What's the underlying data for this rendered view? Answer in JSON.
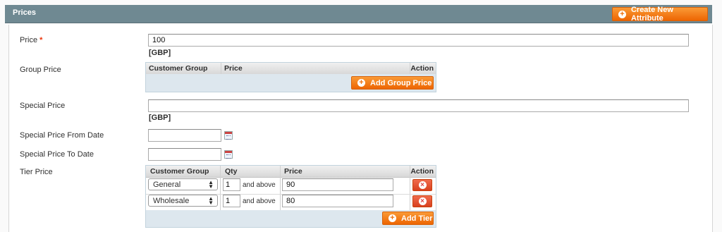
{
  "panel": {
    "title": "Prices",
    "create_attribute_label": "Create New Attribute"
  },
  "fields": {
    "price": {
      "label": "Price",
      "required_mark": "*",
      "value": "100",
      "currency": "[GBP]"
    },
    "group_price": {
      "label": "Group Price",
      "columns": [
        "Customer Group",
        "Price",
        "Action"
      ],
      "add_label": "Add Group Price"
    },
    "special_price": {
      "label": "Special Price",
      "value": "",
      "currency": "[GBP]"
    },
    "special_from": {
      "label": "Special Price From Date",
      "value": ""
    },
    "special_to": {
      "label": "Special Price To Date",
      "value": ""
    },
    "tier_price": {
      "label": "Tier Price",
      "columns": [
        "Customer Group",
        "Qty",
        "Price",
        "Action"
      ],
      "rows": [
        {
          "group": "General",
          "qty": "1",
          "suffix": "and above",
          "price": "90"
        },
        {
          "group": "Wholesale",
          "qty": "1",
          "suffix": "and above",
          "price": "80"
        }
      ],
      "add_label": "Add Tier"
    }
  },
  "icons": {
    "add": "plus-circle-icon",
    "delete": "delete-x-icon",
    "calendar": "calendar-icon"
  },
  "colors": {
    "header": "#6f8992",
    "accent": "#f77c16",
    "grid_footer": "#dde7ee",
    "delete": "#d8401e"
  }
}
